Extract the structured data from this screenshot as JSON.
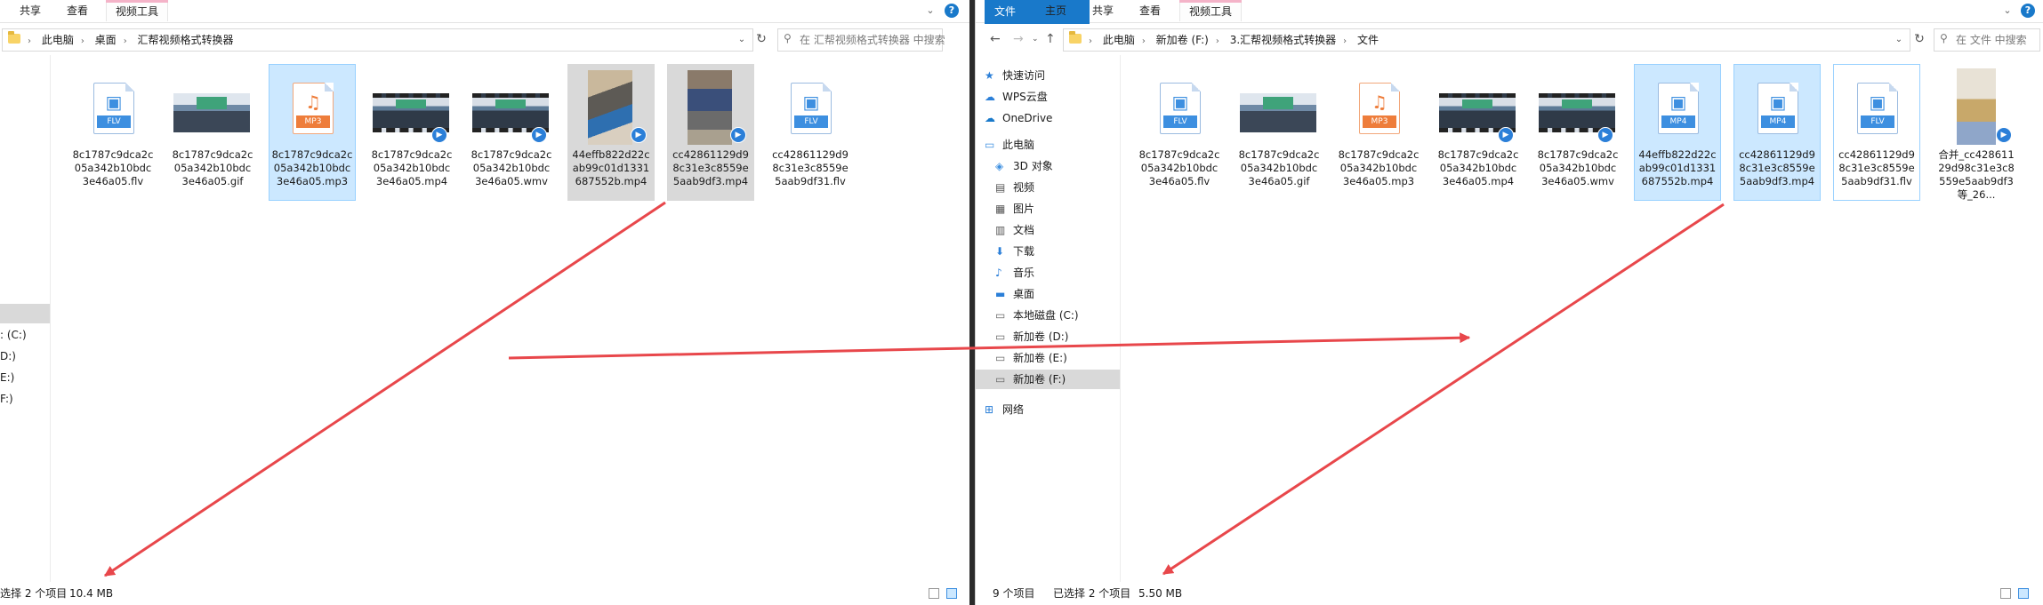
{
  "left": {
    "ribbon": {
      "tabs": [
        "共享",
        "查看",
        "视频工具"
      ]
    },
    "address": {
      "lead": "›",
      "crumbs": [
        "此电脑",
        "桌面",
        "汇帮视频格式转换器"
      ],
      "search_placeholder": "在 汇帮视频格式转换器 中搜索"
    },
    "nav": [
      "",
      ": (C:)",
      "D:)",
      "E:)",
      "F:)"
    ],
    "files": [
      {
        "name": "8c1787c9dca2c05a342b10bdc3e46a05.flv",
        "thumb": "flv",
        "badge": "FLV",
        "state": ""
      },
      {
        "name": "8c1787c9dca2c05a342b10bdc3e46a05.gif",
        "thumb": "photo",
        "state": ""
      },
      {
        "name": "8c1787c9dca2c05a342b10bdc3e46a05.mp3",
        "thumb": "mp3",
        "badge": "MP3",
        "state": "selected"
      },
      {
        "name": "8c1787c9dca2c05a342b10bdc3e46a05.mp4",
        "thumb": "video",
        "state": ""
      },
      {
        "name": "8c1787c9dca2c05a342b10bdc3e46a05.wmv",
        "thumb": "video",
        "state": ""
      },
      {
        "name": "44effb822d22cab99c01d1331687552b.mp4",
        "thumb": "portrait",
        "state": "hilite"
      },
      {
        "name": "cc42861129d98c31e3c8559e5aab9df3.mp4",
        "thumb": "portrait2",
        "state": "hilite"
      },
      {
        "name": "cc42861129d98c31e3c8559e5aab9df31.flv",
        "thumb": "flv",
        "badge": "FLV",
        "state": ""
      }
    ],
    "status": {
      "selected": "选择 2 个项目",
      "size": "10.4 MB"
    }
  },
  "right": {
    "ribbon": {
      "tabs": [
        "文件",
        "主页",
        "共享",
        "查看",
        "视频工具"
      ]
    },
    "address": {
      "crumbs": [
        "此电脑",
        "新加卷 (F:)",
        "3.汇帮视频格式转换器",
        "文件"
      ],
      "search_placeholder": "在 文件 中搜索"
    },
    "nav": [
      {
        "label": "快速访问",
        "icon": "star-icon"
      },
      {
        "label": "WPS云盘",
        "icon": "cloud-icon"
      },
      {
        "label": "OneDrive",
        "icon": "onedrive-icon"
      },
      {
        "label": "此电脑",
        "icon": "computer-icon"
      },
      {
        "label": "3D 对象",
        "icon": "cube-icon"
      },
      {
        "label": "视频",
        "icon": "video-folder-icon"
      },
      {
        "label": "图片",
        "icon": "picture-folder-icon"
      },
      {
        "label": "文档",
        "icon": "document-folder-icon"
      },
      {
        "label": "下载",
        "icon": "download-icon"
      },
      {
        "label": "音乐",
        "icon": "music-icon"
      },
      {
        "label": "桌面",
        "icon": "desktop-icon"
      },
      {
        "label": "本地磁盘 (C:)",
        "icon": "drive-icon"
      },
      {
        "label": "新加卷 (D:)",
        "icon": "drive-icon"
      },
      {
        "label": "新加卷 (E:)",
        "icon": "drive-icon"
      },
      {
        "label": "新加卷 (F:)",
        "icon": "drive-icon"
      },
      {
        "label": "网络",
        "icon": "network-icon"
      }
    ],
    "files": [
      {
        "name": "8c1787c9dca2c05a342b10bdc3e46a05.flv",
        "thumb": "flv",
        "badge": "FLV",
        "state": ""
      },
      {
        "name": "8c1787c9dca2c05a342b10bdc3e46a05.gif",
        "thumb": "photo",
        "state": ""
      },
      {
        "name": "8c1787c9dca2c05a342b10bdc3e46a05.mp3",
        "thumb": "mp3",
        "badge": "MP3",
        "state": ""
      },
      {
        "name": "8c1787c9dca2c05a342b10bdc3e46a05.mp4",
        "thumb": "video",
        "state": ""
      },
      {
        "name": "8c1787c9dca2c05a342b10bdc3e46a05.wmv",
        "thumb": "video",
        "state": ""
      },
      {
        "name": "44effb822d22cab99c01d1331687552b.mp4",
        "thumb": "mp4",
        "badge": "MP4",
        "state": "selected"
      },
      {
        "name": "cc42861129d98c31e3c8559e5aab9df3.mp4",
        "thumb": "mp4",
        "badge": "MP4",
        "state": "selected"
      },
      {
        "name": "cc42861129d98c31e3c8559e5aab9df31.flv",
        "thumb": "flv",
        "badge": "FLV",
        "state": "focus"
      },
      {
        "name": "合并_cc42861129d98c31e3c8559e5aab9df3等_26...",
        "thumb": "bottle",
        "state": ""
      }
    ],
    "status": {
      "count": "9 个项目",
      "selected": "已选择 2 个项目",
      "size": "5.50 MB"
    }
  },
  "colors": {
    "selection": "#cce8ff",
    "selection_border": "#99d1ff",
    "arrow": "#e8474b",
    "file_tab": "#1979ca"
  }
}
